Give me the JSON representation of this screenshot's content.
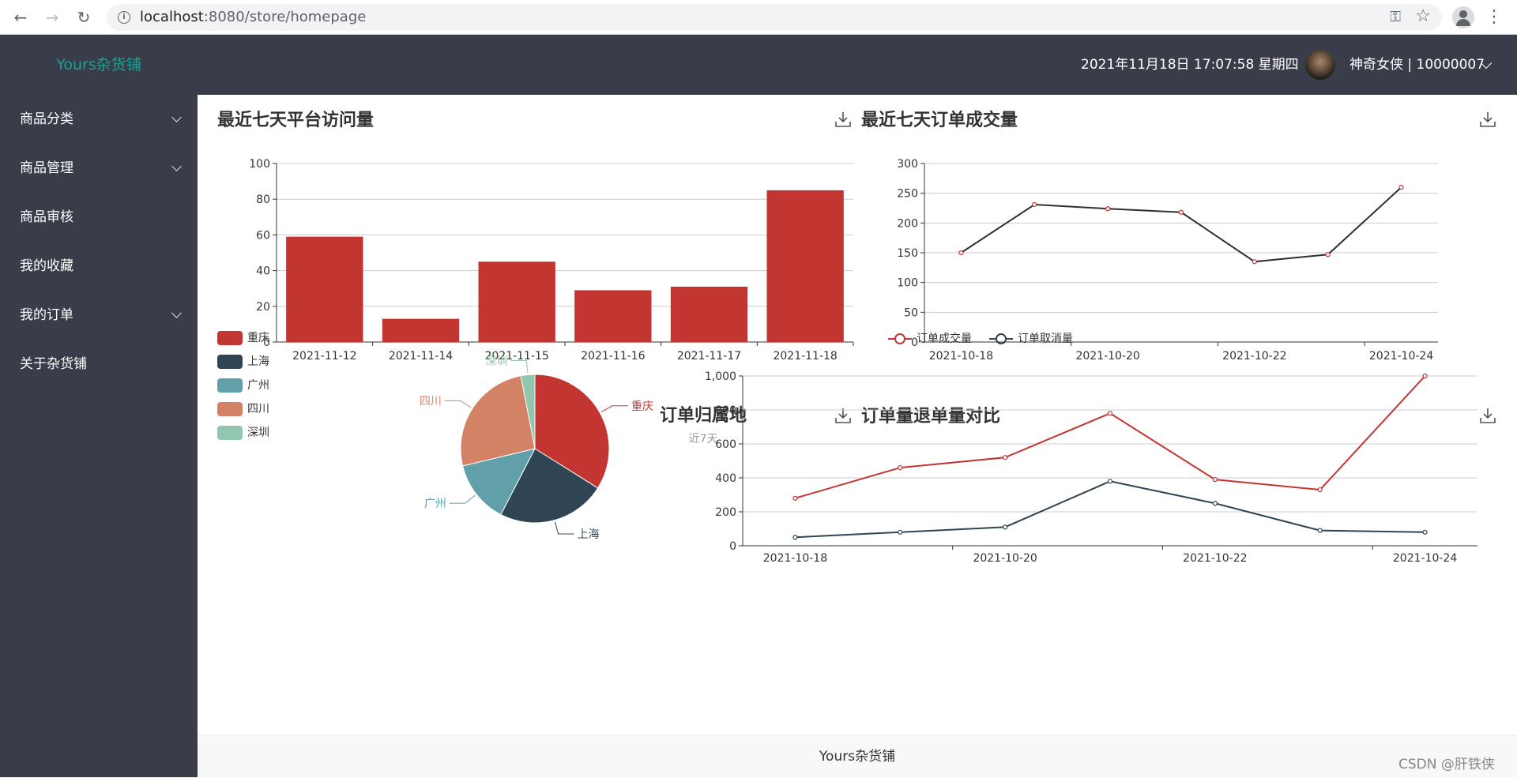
{
  "browser": {
    "url_host": "localhost",
    "url_rest": ":8080/store/homepage"
  },
  "header": {
    "logo": "Yours杂货铺",
    "datetime": "2021年11月18日 17:07:58 星期四",
    "user": "神奇女侠 | 10000007"
  },
  "sidebar": {
    "items": [
      {
        "label": "商品分类",
        "expandable": true
      },
      {
        "label": "商品管理",
        "expandable": true
      },
      {
        "label": "商品审核",
        "expandable": false
      },
      {
        "label": "我的收藏",
        "expandable": false
      },
      {
        "label": "我的订单",
        "expandable": true
      },
      {
        "label": "关于杂货铺",
        "expandable": false
      }
    ]
  },
  "panels": {
    "visits_title": "最近七天平台访问量",
    "orders_title": "最近七天订单成交量",
    "region_title": "订单归属地",
    "region_subtitle": "近7天",
    "compare_title": "订单量退单量对比"
  },
  "footer": {
    "text": "Yours杂货铺"
  },
  "watermark": "CSDN @肝铁侠",
  "colors": {
    "header_bg": "#393d49",
    "logo": "#1aa094",
    "bar": "#c23531",
    "line_dark": "#2f4554"
  },
  "chart_data": [
    {
      "type": "bar",
      "categories": [
        "2021-11-12",
        "2021-11-14",
        "2021-11-15",
        "2021-11-16",
        "2021-11-17",
        "2021-11-18"
      ],
      "values": [
        59,
        13,
        45,
        29,
        31,
        85
      ],
      "ylim": [
        0,
        100
      ],
      "yticks": [
        0,
        20,
        40,
        60,
        80,
        100
      ],
      "grid": true
    },
    {
      "type": "line",
      "x": [
        "2021-10-18",
        "2021-10-19",
        "2021-10-20",
        "2021-10-21",
        "2021-10-22",
        "2021-10-23",
        "2021-10-24"
      ],
      "xticks": [
        "2021-10-18",
        "2021-10-20",
        "2021-10-22",
        "2021-10-24"
      ],
      "values": [
        150,
        231,
        224,
        218,
        135,
        147,
        260
      ],
      "ylim": [
        0,
        300
      ],
      "yticks": [
        0,
        50,
        100,
        150,
        200,
        250,
        300
      ],
      "grid": true
    },
    {
      "type": "pie",
      "legend": [
        "重庆",
        "上海",
        "广州",
        "四川",
        "深圳"
      ],
      "values": [
        335,
        234,
        135,
        254,
        30
      ],
      "colors": [
        "#c23531",
        "#2f4554",
        "#61a0a8",
        "#d48265",
        "#91c7ae"
      ],
      "legend_position": "left"
    },
    {
      "type": "line",
      "x": [
        "2021-10-18",
        "2021-10-19",
        "2021-10-20",
        "2021-10-21",
        "2021-10-22",
        "2021-10-23",
        "2021-10-24"
      ],
      "xticks": [
        "2021-10-18",
        "2021-10-20",
        "2021-10-22",
        "2021-10-24"
      ],
      "series": [
        {
          "name": "订单成交量",
          "values": [
            280,
            460,
            520,
            780,
            390,
            330,
            1000
          ],
          "color": "#c23531"
        },
        {
          "name": "订单取消量",
          "values": [
            50,
            80,
            110,
            380,
            250,
            90,
            80
          ],
          "color": "#2f4554"
        }
      ],
      "ylim": [
        0,
        1000
      ],
      "yticks": [
        "0",
        "200",
        "400",
        "600",
        "800",
        "1,000"
      ],
      "legend_position": "top",
      "grid": true
    }
  ]
}
